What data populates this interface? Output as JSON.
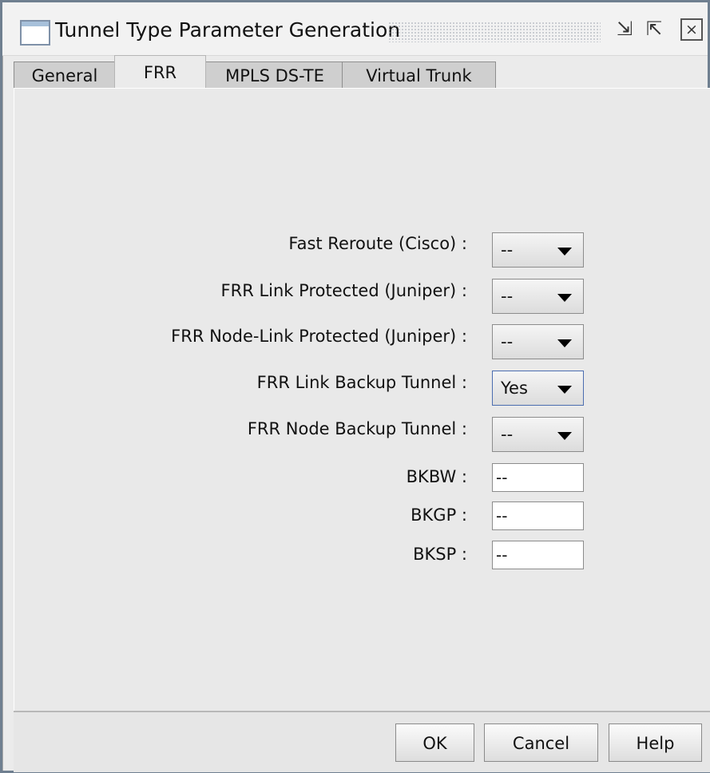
{
  "window": {
    "title": "Tunnel Type Parameter Generation",
    "icon_buttons": [
      "minimize-icon",
      "maximize-icon",
      "close-icon"
    ]
  },
  "tabs": [
    {
      "label": "General",
      "active": false
    },
    {
      "label": "FRR",
      "active": true
    },
    {
      "label": "MPLS DS-TE",
      "active": false
    },
    {
      "label": "Virtual Trunk",
      "active": false
    }
  ],
  "fields": {
    "fast_reroute_cisco": {
      "label": "Fast Reroute (Cisco) :",
      "value": "--"
    },
    "frr_link_protected_juniper": {
      "label": "FRR Link Protected (Juniper) :",
      "value": "--"
    },
    "frr_node_link_protected_juniper": {
      "label": "FRR Node-Link Protected (Juniper) :",
      "value": "--"
    },
    "frr_link_backup_tunnel": {
      "label": "FRR Link Backup Tunnel :",
      "value": "Yes"
    },
    "frr_node_backup_tunnel": {
      "label": "FRR Node Backup Tunnel :",
      "value": "--"
    },
    "bkbw": {
      "label": "BKBW :",
      "value": "--"
    },
    "bkgp": {
      "label": "BKGP :",
      "value": "--"
    },
    "bksp": {
      "label": "BKSP :",
      "value": "--"
    }
  },
  "buttons": {
    "ok": "OK",
    "cancel": "Cancel",
    "help": "Help"
  }
}
